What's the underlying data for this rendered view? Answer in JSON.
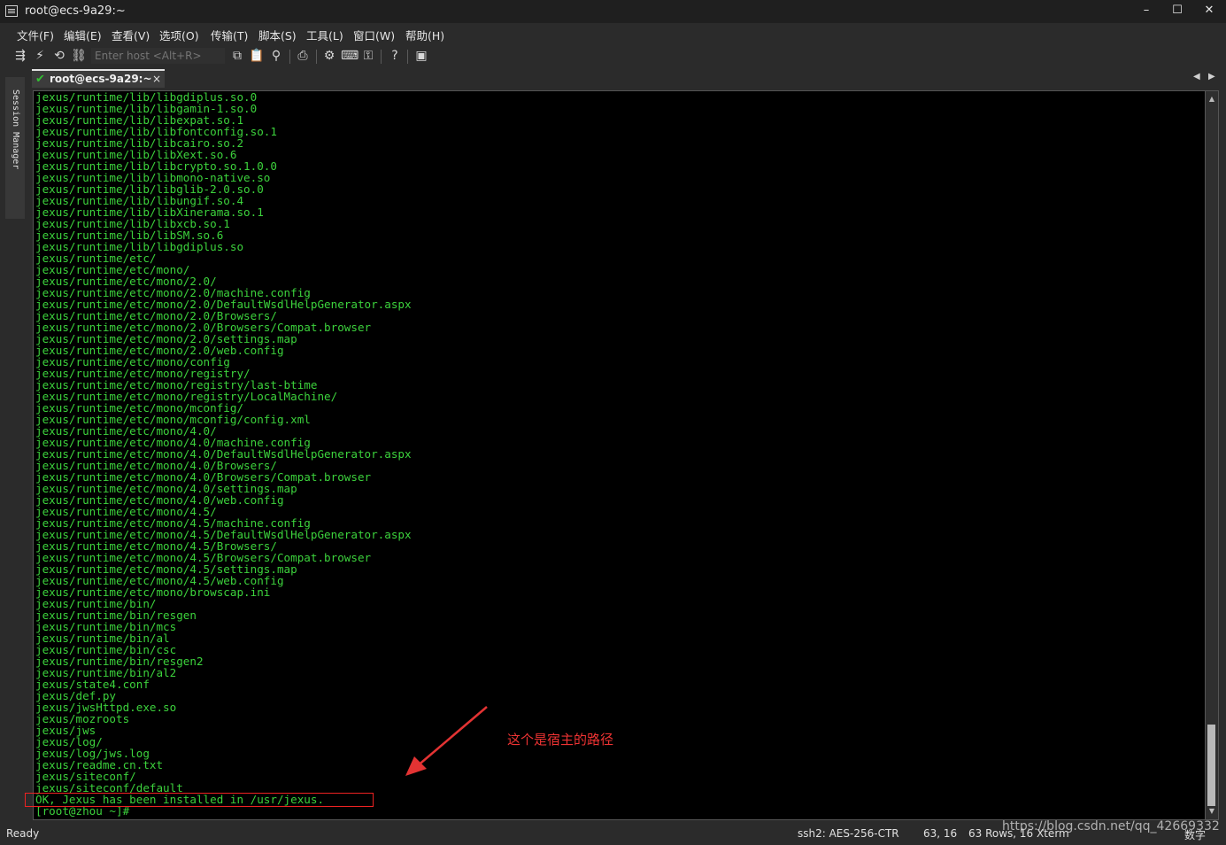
{
  "window": {
    "title": "root@ecs-9a29:~",
    "minimize": "–",
    "maximize": "☐",
    "close": "✕"
  },
  "menu": [
    "文件(F)",
    "编辑(E)",
    "查看(V)",
    "选项(O)",
    "传输(T)",
    "脚本(S)",
    "工具(L)",
    "窗口(W)",
    "帮助(H)"
  ],
  "toolbar": {
    "host_placeholder": "Enter host <Alt+R>"
  },
  "sidebar": {
    "label": "Session Manager"
  },
  "tab": {
    "label": "root@ecs-9a29:~",
    "close": "×"
  },
  "terminal": {
    "lines": [
      "jexus/runtime/lib/libgdiplus.so.0",
      "jexus/runtime/lib/libgamin-1.so.0",
      "jexus/runtime/lib/libexpat.so.1",
      "jexus/runtime/lib/libfontconfig.so.1",
      "jexus/runtime/lib/libcairo.so.2",
      "jexus/runtime/lib/libXext.so.6",
      "jexus/runtime/lib/libcrypto.so.1.0.0",
      "jexus/runtime/lib/libmono-native.so",
      "jexus/runtime/lib/libglib-2.0.so.0",
      "jexus/runtime/lib/libungif.so.4",
      "jexus/runtime/lib/libXinerama.so.1",
      "jexus/runtime/lib/libxcb.so.1",
      "jexus/runtime/lib/libSM.so.6",
      "jexus/runtime/lib/libgdiplus.so",
      "jexus/runtime/etc/",
      "jexus/runtime/etc/mono/",
      "jexus/runtime/etc/mono/2.0/",
      "jexus/runtime/etc/mono/2.0/machine.config",
      "jexus/runtime/etc/mono/2.0/DefaultWsdlHelpGenerator.aspx",
      "jexus/runtime/etc/mono/2.0/Browsers/",
      "jexus/runtime/etc/mono/2.0/Browsers/Compat.browser",
      "jexus/runtime/etc/mono/2.0/settings.map",
      "jexus/runtime/etc/mono/2.0/web.config",
      "jexus/runtime/etc/mono/config",
      "jexus/runtime/etc/mono/registry/",
      "jexus/runtime/etc/mono/registry/last-btime",
      "jexus/runtime/etc/mono/registry/LocalMachine/",
      "jexus/runtime/etc/mono/mconfig/",
      "jexus/runtime/etc/mono/mconfig/config.xml",
      "jexus/runtime/etc/mono/4.0/",
      "jexus/runtime/etc/mono/4.0/machine.config",
      "jexus/runtime/etc/mono/4.0/DefaultWsdlHelpGenerator.aspx",
      "jexus/runtime/etc/mono/4.0/Browsers/",
      "jexus/runtime/etc/mono/4.0/Browsers/Compat.browser",
      "jexus/runtime/etc/mono/4.0/settings.map",
      "jexus/runtime/etc/mono/4.0/web.config",
      "jexus/runtime/etc/mono/4.5/",
      "jexus/runtime/etc/mono/4.5/machine.config",
      "jexus/runtime/etc/mono/4.5/DefaultWsdlHelpGenerator.aspx",
      "jexus/runtime/etc/mono/4.5/Browsers/",
      "jexus/runtime/etc/mono/4.5/Browsers/Compat.browser",
      "jexus/runtime/etc/mono/4.5/settings.map",
      "jexus/runtime/etc/mono/4.5/web.config",
      "jexus/runtime/etc/mono/browscap.ini",
      "jexus/runtime/bin/",
      "jexus/runtime/bin/resgen",
      "jexus/runtime/bin/mcs",
      "jexus/runtime/bin/al",
      "jexus/runtime/bin/csc",
      "jexus/runtime/bin/resgen2",
      "jexus/runtime/bin/al2",
      "jexus/state4.conf",
      "jexus/def.py",
      "jexus/jwsHttpd.exe.so",
      "jexus/mozroots",
      "jexus/jws",
      "jexus/log/",
      "jexus/log/jws.log",
      "jexus/readme.cn.txt",
      "jexus/siteconf/",
      "jexus/siteconf/default",
      "OK, Jexus has been installed in /usr/jexus.",
      "[root@zhou ~]#"
    ]
  },
  "annotation": {
    "text": "这个是宿主的路径",
    "color": "#e33333"
  },
  "status": {
    "ready": "Ready",
    "cipher": "ssh2: AES-256-CTR",
    "position": "63,  16",
    "size": "63 Rows, 16 Xterm",
    "mode": "数字",
    "watermark": "https://blog.csdn.net/qq_42669332"
  }
}
